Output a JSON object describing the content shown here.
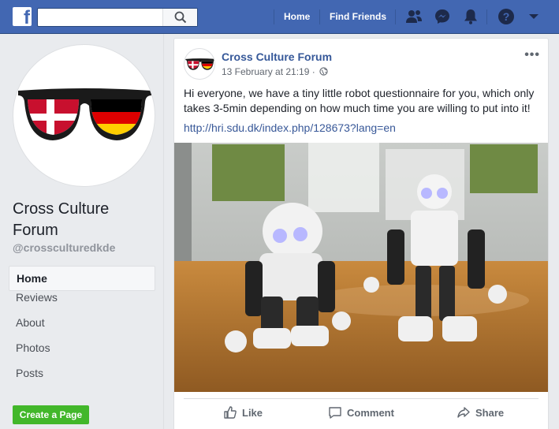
{
  "topbar": {
    "logo_letter": "f",
    "search_placeholder": "",
    "nav": {
      "home": "Home",
      "find_friends": "Find Friends"
    },
    "colors": {
      "bar": "#4267b2",
      "accent_green": "#42b72a"
    },
    "icons": [
      "search-icon",
      "friend-requests-icon",
      "messenger-icon",
      "notifications-icon",
      "help-icon",
      "account-menu-icon"
    ]
  },
  "sidebar": {
    "page_name": "Cross Culture Forum",
    "handle": "@crossculturedkde",
    "items": [
      {
        "label": "Home",
        "active": true
      },
      {
        "label": "Reviews"
      },
      {
        "label": "About"
      },
      {
        "label": "Photos"
      },
      {
        "label": "Posts"
      }
    ],
    "create_page": "Create a Page"
  },
  "post": {
    "author": "Cross Culture Forum",
    "date": "13 February at 21:19 ·",
    "text": "Hi everyone, we have a tiny little robot questionnaire for you, which only takes 3-5min depending on how much time you are willing to put into it!",
    "link": "http://hri.sdu.dk/index.php/128673?lang=en",
    "actions": {
      "like": "Like",
      "comment": "Comment",
      "share": "Share"
    }
  }
}
